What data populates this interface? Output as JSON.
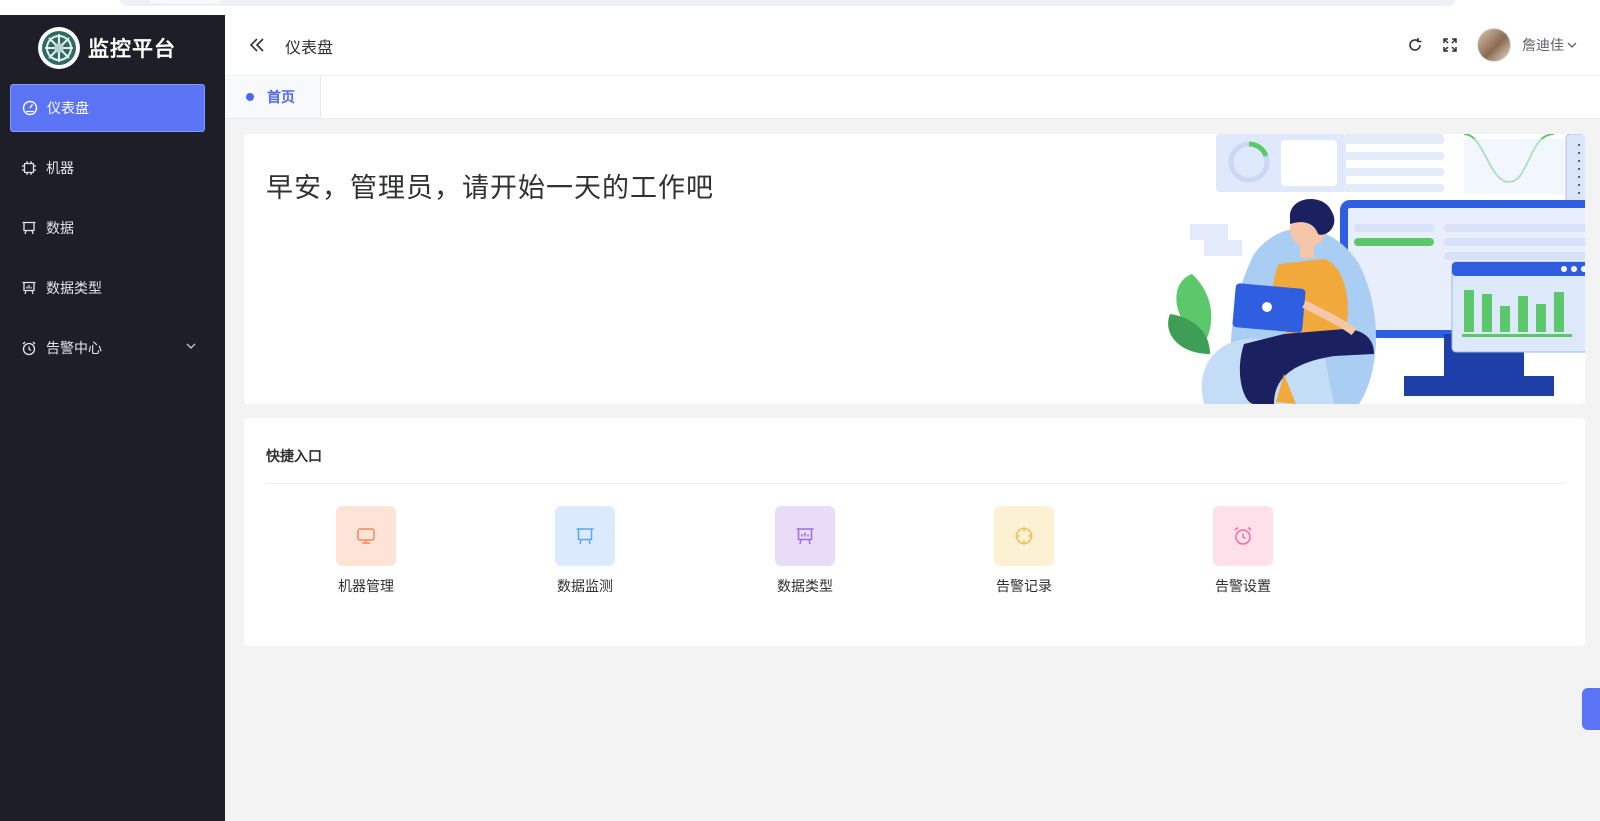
{
  "app": {
    "title": "监控平台"
  },
  "sidebar": {
    "items": [
      {
        "label": "仪表盘",
        "icon": "dashboard-icon",
        "active": true
      },
      {
        "label": "机器",
        "icon": "cpu-icon"
      },
      {
        "label": "数据",
        "icon": "board-icon"
      },
      {
        "label": "数据类型",
        "icon": "chart-board-icon"
      },
      {
        "label": "告警中心",
        "icon": "alarm-clock-icon",
        "expandable": true
      }
    ]
  },
  "header": {
    "breadcrumb": "仪表盘",
    "username": "詹迪佳",
    "icons": [
      "collapse-icon",
      "refresh-icon",
      "fullscreen-icon",
      "chevron-down-icon"
    ]
  },
  "tabs": [
    {
      "label": "首页",
      "active": true
    }
  ],
  "welcome": {
    "greeting": "早安，管理员，请开始一天的工作吧"
  },
  "quick_entry": {
    "title": "快捷入口",
    "items": [
      {
        "label": "机器管理",
        "icon": "monitor-icon",
        "bg": "#fde4d6",
        "color": "#f08a5a"
      },
      {
        "label": "数据监测",
        "icon": "board-icon",
        "bg": "#dbeafc",
        "color": "#5aa7f0"
      },
      {
        "label": "数据类型",
        "icon": "chart-board-icon",
        "bg": "#e8dcf8",
        "color": "#9a6fe0"
      },
      {
        "label": "告警记录",
        "icon": "target-icon",
        "bg": "#fdf1d3",
        "color": "#f2c25a"
      },
      {
        "label": "告警设置",
        "icon": "alarm-clock-icon",
        "bg": "#fde0ea",
        "color": "#ef6f96"
      }
    ]
  },
  "colors": {
    "sidebar_bg": "#1d1e27",
    "accent": "#5b73f5",
    "page_bg": "#f3f3f4"
  }
}
